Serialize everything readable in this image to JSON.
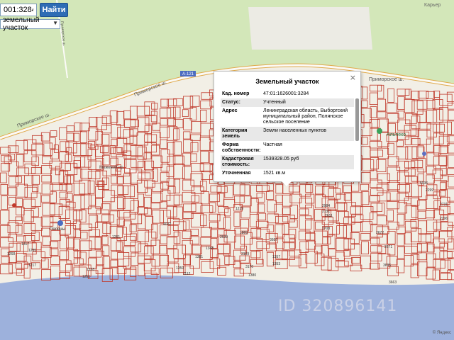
{
  "search": {
    "value": "001:3284",
    "button": "Найти"
  },
  "layer_select": {
    "value": "земельный участок"
  },
  "map_labels": {
    "karier_top": "Карьер",
    "road_primorskoe_1": "Приморское ш.",
    "road_primorskoe_2": "Приморское ш.",
    "road_primorskoe_3": "Приморское ш.",
    "road_small_1": "Приморское ш.",
    "road_number": "А-121",
    "street_mezhevoy": "Межевой пр.",
    "alpeo": "Альпеко",
    "bus_stop": "Поляны",
    "parcel_numbers": [
      "1317",
      "2731",
      "5036",
      "2299",
      "2296",
      "1285",
      "1268",
      "1261",
      "1217",
      "1228",
      "1251",
      "1112",
      "1359",
      "1357",
      "1353",
      "3169",
      "3170",
      "1380",
      "1381",
      "1348",
      "3695",
      "3663",
      "2984",
      "2131",
      "2671",
      "2672",
      "4022",
      "1219",
      "3708",
      "2611",
      "2639",
      "1869",
      "3687"
    ]
  },
  "popup": {
    "title": "Земельный участок",
    "close": "×",
    "rows": [
      {
        "k": "Кад. номер",
        "v": "47:01:1626001:3284"
      },
      {
        "k": "Статус:",
        "v": "Учтенный"
      },
      {
        "k": "Адрес",
        "v": "Ленинградская область, Выборгский муниципальный район, Полянское сельское поселение"
      },
      {
        "k": "Категория земель",
        "v": "Земли населенных пунктов"
      },
      {
        "k": "Форма собственности:",
        "v": "Частная"
      },
      {
        "k": "Кадастровая стоимость:",
        "v": "1539328.05 руб"
      },
      {
        "k": "Уточненная площадь:",
        "v": "1521 кв.м"
      }
    ]
  },
  "watermark": "ID 320896141",
  "credit": "© Яндекс",
  "colors": {
    "forest": "#d3e7b9",
    "water": "#9db1dc",
    "land": "#f2efe6",
    "road": "#fbfaf7",
    "parcel": "#c0392b",
    "popup_alt": "#e8e8e8"
  }
}
